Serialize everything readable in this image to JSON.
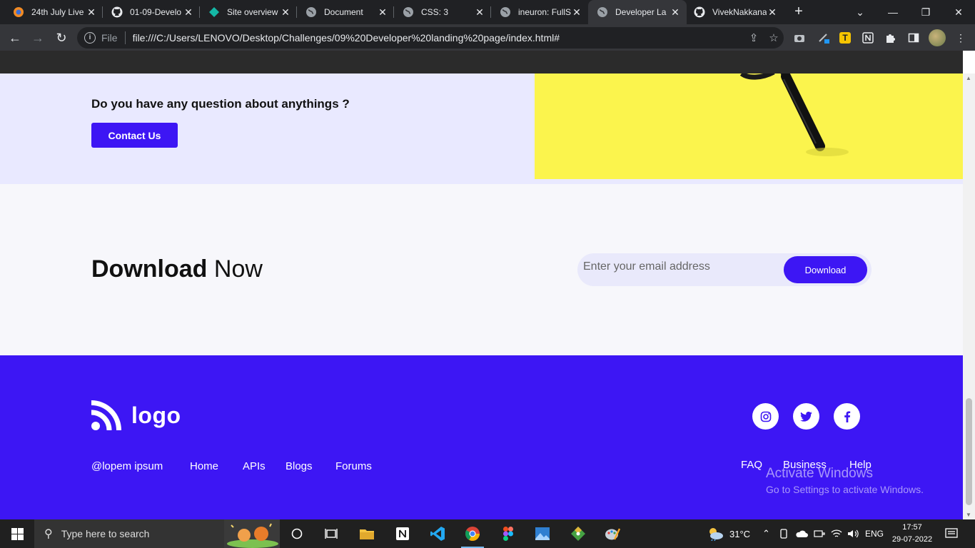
{
  "browser": {
    "tabs": [
      {
        "title": "24th July Live",
        "icon": "orange-circle-icon"
      },
      {
        "title": "01-09-Develo",
        "icon": "github-icon"
      },
      {
        "title": "Site overview",
        "icon": "diamond-icon"
      },
      {
        "title": "Document",
        "icon": "globe-icon"
      },
      {
        "title": "CSS: 3",
        "icon": "globe-icon"
      },
      {
        "title": "ineuron: FullS",
        "icon": "globe-icon"
      },
      {
        "title": "Developer La",
        "icon": "globe-icon",
        "active": true
      },
      {
        "title": "VivekNakkana",
        "icon": "github-icon"
      }
    ],
    "scheme_label": "File",
    "url": "file:///C:/Users/LENOVO/Desktop/Challenges/09%20Developer%20landing%20page/index.html#",
    "extension_t_label": "T"
  },
  "page": {
    "faq": {
      "question": "Do you have any question about anythings ?",
      "contact_label": "Contact Us"
    },
    "download": {
      "title_bold": "Download",
      "title_rest": " Now",
      "email_placeholder": "Enter your email address",
      "button_label": "Download"
    },
    "footer": {
      "logo_text": "logo",
      "left_links": [
        "@lopem ipsum",
        "Home",
        "APIs",
        "Blogs",
        "Forums"
      ],
      "right_links": [
        "FAQ",
        "Business",
        "Help"
      ],
      "social": [
        "instagram-icon",
        "twitter-icon",
        "facebook-icon"
      ],
      "accent_color": "#3d16f4"
    },
    "watermark": {
      "line1": "Activate Windows",
      "line2": "Go to Settings to activate Windows."
    }
  },
  "taskbar": {
    "search_placeholder": "Type here to search",
    "temperature": "31°C",
    "language": "ENG",
    "time": "17:57",
    "date": "29-07-2022"
  }
}
